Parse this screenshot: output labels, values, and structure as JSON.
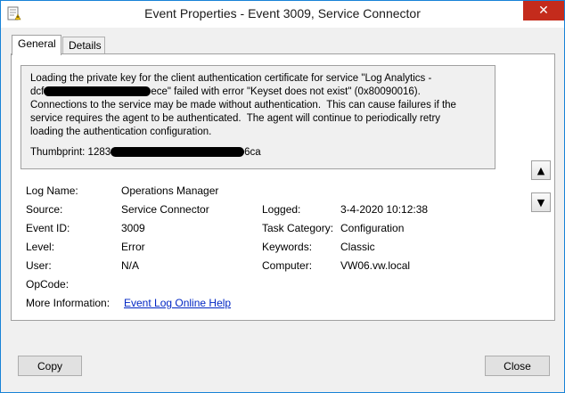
{
  "window": {
    "title": "Event Properties - Event 3009, Service Connector",
    "close_glyph": "✕",
    "accent": "#1883d7",
    "close_color": "#c42b1c"
  },
  "tabs": [
    {
      "label": "General",
      "active": true
    },
    {
      "label": "Details",
      "active": false
    }
  ],
  "description": {
    "line1": "Loading the private key for the client authentication certificate for service \"Log Analytics -",
    "line2_start": "dcf",
    "line2_end": "ece\" failed with error \"Keyset does not exist\" (0x80090016).",
    "line3": "Connections to the service may be made without authentication.  This can cause failures if the",
    "line4": "service requires the agent to be authenticated.  The agent will continue to periodically retry",
    "line5": "loading the authentication configuration.",
    "thumb_start": "Thumbprint: 1283",
    "thumb_end": "6ca"
  },
  "nav": {
    "up_icon": "arrow-up-icon",
    "down_icon": "arrow-down-icon",
    "up_glyph": "▲",
    "down_glyph": "▼"
  },
  "fields": {
    "log_name": {
      "label": "Log Name:",
      "value": "Operations Manager"
    },
    "source": {
      "label": "Source:",
      "value": "Service Connector"
    },
    "logged": {
      "label": "Logged:",
      "value": "3-4-2020 10:12:38"
    },
    "event_id": {
      "label": "Event ID:",
      "value": "3009"
    },
    "task_category": {
      "label": "Task Category:",
      "value": "Configuration"
    },
    "level": {
      "label": "Level:",
      "value": "Error"
    },
    "keywords": {
      "label": "Keywords:",
      "value": "Classic"
    },
    "user": {
      "label": "User:",
      "value": "N/A"
    },
    "computer": {
      "label": "Computer:",
      "value": "VW06.vw.local"
    },
    "opcode": {
      "label": "OpCode:",
      "value": ""
    },
    "more_info": {
      "label": "More Information:",
      "link": "Event Log Online Help"
    }
  },
  "buttons": {
    "copy": "Copy",
    "close": "Close"
  }
}
